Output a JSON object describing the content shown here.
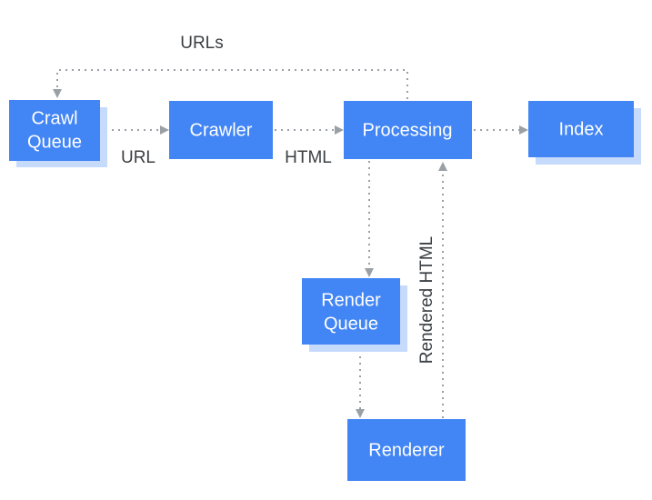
{
  "colors": {
    "node": "#4285f4",
    "stack": "#c6dafc",
    "edge": "#9aa0a6",
    "label": "#3c4043"
  },
  "nodes": {
    "crawl_queue": {
      "line1": "Crawl",
      "line2": "Queue"
    },
    "crawler": {
      "label": "Crawler"
    },
    "processing": {
      "label": "Processing"
    },
    "index": {
      "label": "Index"
    },
    "render_queue": {
      "line1": "Render",
      "line2": "Queue"
    },
    "renderer": {
      "label": "Renderer"
    }
  },
  "edge_labels": {
    "urls": "URLs",
    "url": "URL",
    "html": "HTML",
    "rendered_html": "Rendered HTML"
  }
}
